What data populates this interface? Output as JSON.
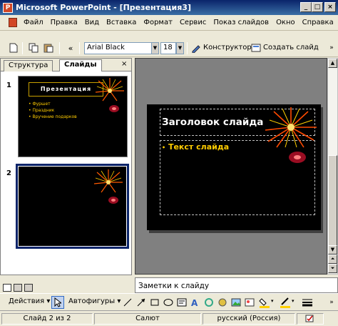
{
  "window": {
    "title": "Microsoft PowerPoint - [Презентация3]",
    "app_icon": "P"
  },
  "window_buttons": {
    "minimize": "_",
    "maximize": "□",
    "close": "×"
  },
  "menu": [
    "Файл",
    "Правка",
    "Вид",
    "Вставка",
    "Формат",
    "Сервис",
    "Показ слайдов",
    "Окно",
    "Справка"
  ],
  "toolbar": {
    "font_name": "Arial Black",
    "font_size": "18",
    "designer_label": "Конструктор",
    "new_slide_label": "Создать слайд"
  },
  "tabs": {
    "outline": "Структура",
    "slides": "Слайды"
  },
  "thumbnails": [
    {
      "number": "1",
      "title": "Презентация",
      "bullets": [
        "Фуршет",
        "Праздник",
        "Вручение подарков"
      ],
      "selected": false
    },
    {
      "number": "2",
      "selected": true
    }
  ],
  "slide": {
    "title_placeholder": "Заголовок слайда",
    "text_placeholder": "Текст слайда"
  },
  "notes_placeholder": "Заметки к слайду",
  "drawing_toolbar": {
    "actions_label": "Действия",
    "autoshapes_label": "Автофигуры"
  },
  "status": {
    "slide_counter": "Слайд 2 из 2",
    "design_name": "Салют",
    "language": "русский (Россия)"
  },
  "colors": {
    "title_bar": "#0a246a",
    "slide_bg": "#000000",
    "slide_title": "#ffffff",
    "bullet_text": "#ffcc00",
    "workspace": "#808080"
  }
}
